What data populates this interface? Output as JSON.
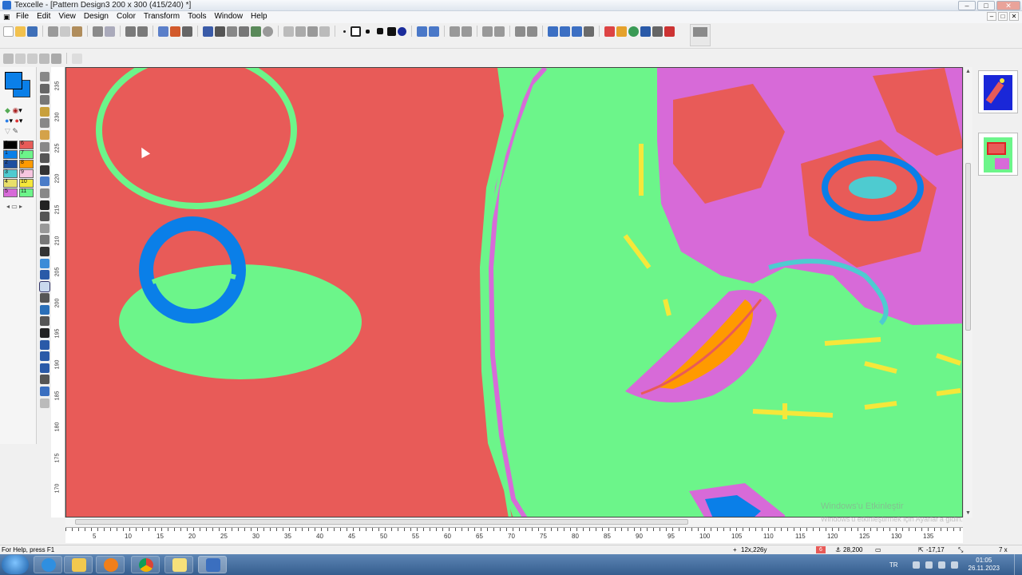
{
  "window": {
    "title": "Texcelle - [Pattern Design3 200 x 300 (415/240) *]",
    "controls": [
      "‒",
      "□",
      "✕"
    ]
  },
  "menu": {
    "items": [
      "File",
      "Edit",
      "View",
      "Design",
      "Color",
      "Transform",
      "Tools",
      "Window",
      "Help"
    ]
  },
  "palette": {
    "selected_color": "#0a7fe8",
    "swatches": [
      {
        "index": "0",
        "color": "#000000"
      },
      {
        "index": "6",
        "color": "#e85b58"
      },
      {
        "index": "1",
        "color": "#0a7fe8"
      },
      {
        "index": "7",
        "color": "#6cf58a"
      },
      {
        "index": "2",
        "color": "#1e4fa0"
      },
      {
        "index": "8",
        "color": "#ff9a00"
      },
      {
        "index": "3",
        "color": "#4ecbd0"
      },
      {
        "index": "9",
        "color": "#f7c6e0"
      },
      {
        "index": "4",
        "color": "#e8e06a"
      },
      {
        "index": "10",
        "color": "#f5e73a"
      },
      {
        "index": "5",
        "color": "#d76ad8"
      },
      {
        "index": "11",
        "color": "#6cf58a"
      }
    ]
  },
  "vertical_ruler": [
    "235",
    "230",
    "225",
    "220",
    "215",
    "210",
    "205",
    "200",
    "195",
    "190",
    "185",
    "180",
    "175",
    "170"
  ],
  "horizontal_ruler": [
    "5",
    "10",
    "15",
    "20",
    "25",
    "30",
    "35",
    "40",
    "45",
    "50",
    "55",
    "60",
    "65",
    "70",
    "75",
    "80",
    "85",
    "90",
    "95",
    "100",
    "105",
    "110",
    "115",
    "120",
    "125",
    "130",
    "135"
  ],
  "canvas_colors": {
    "red": "#e85b58",
    "green": "#6cf58a",
    "blue": "#0a7fe8",
    "magenta": "#d76ad8",
    "orange": "#ff9a00",
    "yellow": "#f5e73a",
    "cyan": "#4ecbd0"
  },
  "status": {
    "help": "For Help, press F1",
    "position": "12x,226y",
    "color_index": "6",
    "value": "28,200",
    "offset": "-17,17",
    "zoom": "7 x"
  },
  "watermark": {
    "line1": "Windows'u Etkinleştir",
    "line2": "Windows'u etkinleştirmek için Ayarlar'a gidin."
  },
  "taskbar": {
    "language": "TR",
    "time": "01:05",
    "date": "26.11.2023"
  }
}
